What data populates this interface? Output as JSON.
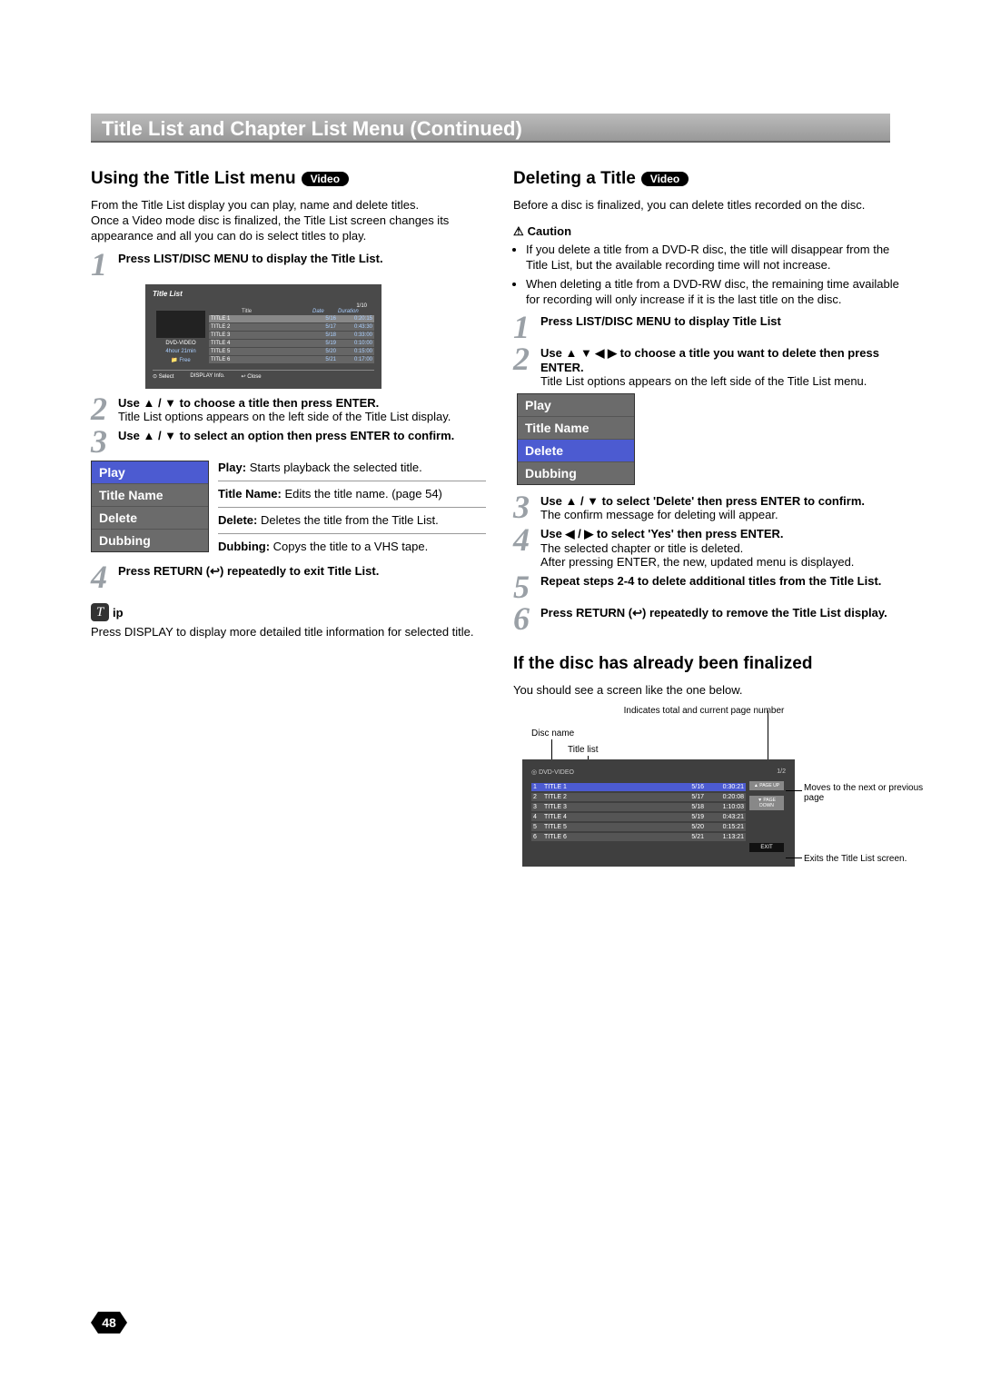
{
  "page_title": "Title List and Chapter List Menu (Continued)",
  "page_number": "48",
  "left": {
    "heading": "Using the Title List menu",
    "video_pill": "Video",
    "intro": "From the Title List display you can play, name and delete titles.\nOnce a Video mode disc is finalized, the Title List screen changes its appearance and all you can do is select titles to play.",
    "step1": "Press LIST/DISC MENU to display the Title List.",
    "titleList": {
      "title": "Title List",
      "pages": "1/10",
      "side_label1": "DVD-VIDEO",
      "side_label2": "4hour 21min",
      "side_label3": "📁 Free",
      "cols": {
        "title": "Title",
        "date": "Date",
        "duration": "Duration"
      },
      "rows": [
        {
          "title": "TITLE 1",
          "date": "5/16",
          "dur": "0:20:15"
        },
        {
          "title": "TITLE 2",
          "date": "5/17",
          "dur": "0:43:30"
        },
        {
          "title": "TITLE 3",
          "date": "5/18",
          "dur": "0:33:00"
        },
        {
          "title": "TITLE 4",
          "date": "5/19",
          "dur": "0:10:00"
        },
        {
          "title": "TITLE 5",
          "date": "5/20",
          "dur": "0:15:00"
        },
        {
          "title": "TITLE 6",
          "date": "5/21",
          "dur": "0:17:00"
        }
      ],
      "footer": {
        "select": "⊙ Select",
        "info": "DISPLAY  Info.",
        "close": "↩ Close"
      }
    },
    "step2_bold": "Use ▲ / ▼ to choose a title then press ENTER.",
    "step2_text": "Title List options appears on the left side of the Title List display.",
    "step3_bold": "Use ▲ / ▼ to select an option then press ENTER to confirm.",
    "options": {
      "play": "Play",
      "titlename": "Title Name",
      "delete": "Delete",
      "dubbing": "Dubbing"
    },
    "desc": {
      "play": "Play: ",
      "play_t": "Starts playback the selected title.",
      "tn": "Title Name: ",
      "tn_t": "Edits the title name. (page 54)",
      "del": "Delete: ",
      "del_t": "Deletes the title from the Title List.",
      "dub": "Dubbing: ",
      "dub_t": "Copys the title to a VHS tape."
    },
    "step4": "Press RETURN (↩) repeatedly to exit Title List.",
    "tip_label": "ip",
    "tip_text": "Press DISPLAY to display more detailed title information for selected title."
  },
  "right": {
    "del_heading": "Deleting a Title",
    "video_pill": "Video",
    "del_intro": "Before a disc is finalized, you can delete titles recorded on the disc.",
    "caution_label": "Caution",
    "caution1": "If you delete a title from a DVD-R disc, the title will disappear from the Title List, but the available recording time will not increase.",
    "caution2": "When deleting a title from a DVD-RW disc, the remaining time available for recording will only increase if it is the last title on the disc.",
    "s1": "Press LIST/DISC MENU to display Title List",
    "s2_b": "Use ▲ ▼ ◀ ▶ to choose a title you want to delete then press ENTER.",
    "s2_t": "Title List options appears on the left side of the Title List menu.",
    "options": {
      "play": "Play",
      "titlename": "Title Name",
      "delete": "Delete",
      "dubbing": "Dubbing"
    },
    "s3_b": "Use ▲ / ▼ to select 'Delete' then press ENTER to confirm.",
    "s3_t": "The confirm message for deleting will appear.",
    "s4_b": "Use ◀ / ▶ to select 'Yes' then press ENTER.",
    "s4_t1": "The selected chapter or title is deleted.",
    "s4_t2": "After pressing ENTER, the new, updated menu is displayed.",
    "s5": "Repeat steps 2-4 to delete additional titles from the Title List.",
    "s6": "Press RETURN (↩) repeatedly to remove the Title List display.",
    "final_heading": "If the disc has already been finalized",
    "final_intro": "You should see a screen like the one below.",
    "fig": {
      "cap_top": "Indicates total and current page number",
      "lbl_disc": "Disc name",
      "lbl_titlelist": "Title list",
      "head_left": "DVD-VIDEO",
      "head_right": "1/2",
      "rows": [
        {
          "n": "1",
          "t": "TITLE 1",
          "d": "5/16",
          "du": "0:30:21"
        },
        {
          "n": "2",
          "t": "TITLE 2",
          "d": "5/17",
          "du": "0:20:08"
        },
        {
          "n": "3",
          "t": "TITLE 3",
          "d": "5/18",
          "du": "1:10:03"
        },
        {
          "n": "4",
          "t": "TITLE 4",
          "d": "5/19",
          "du": "0:43:21"
        },
        {
          "n": "5",
          "t": "TITLE 5",
          "d": "5/20",
          "du": "0:15:21"
        },
        {
          "n": "6",
          "t": "TITLE 6",
          "d": "5/21",
          "du": "1:13:21"
        }
      ],
      "btn_up": "▲ PAGE UP",
      "btn_down": "▼ PAGE DOWN",
      "btn_exit": "EXIT",
      "side_move": "Moves to the next or previous page",
      "side_exit": "Exits the Title List screen."
    }
  }
}
